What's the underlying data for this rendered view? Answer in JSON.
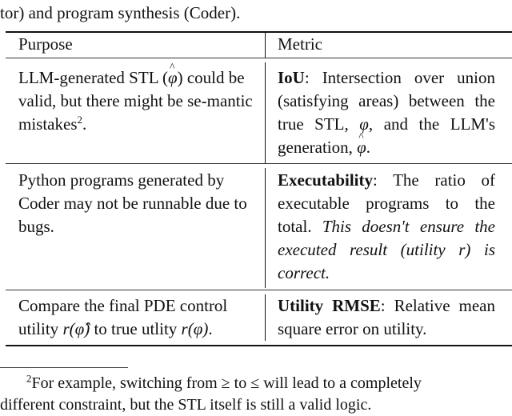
{
  "caption_tail": "tor) and program synthesis (Coder).",
  "table": {
    "headers": {
      "purpose": "Purpose",
      "metric": "Metric"
    },
    "rows": [
      {
        "purpose": [
          "LLM-generated STL (",
          "φ",
          ") could be valid, but there might be se-mantic mistakes",
          "2",
          "."
        ],
        "metric_name": "IoU",
        "metric_text": ": Intersection over union (satisfying areas) between the true STL, ",
        "metric_phi": "φ",
        "metric_mid": ", and the LLM's generation, ",
        "metric_phi_hat": "φ",
        "metric_end": "."
      },
      {
        "purpose": "Python programs generated by Coder may not be runnable due to bugs.",
        "metric_name": "Executability",
        "metric_text": ": The ratio of executable programs to the total. ",
        "metric_italic": "This doesn't ensure the executed result (utility r) is correct."
      },
      {
        "purpose_a": "Compare the final PDE control utility ",
        "purpose_math1": "r(φ̂)",
        "purpose_b": " to true utlity ",
        "purpose_math2": "r(φ)",
        "purpose_c": ".",
        "metric_name": "Utility RMSE",
        "metric_text": ": Relative mean square error on utility."
      }
    ]
  },
  "footnote": {
    "marker": "2",
    "line1": "For example, switching from ≥ to ≤ will lead to a completely",
    "line2": "different constraint, but the STL itself is still a valid logic."
  }
}
